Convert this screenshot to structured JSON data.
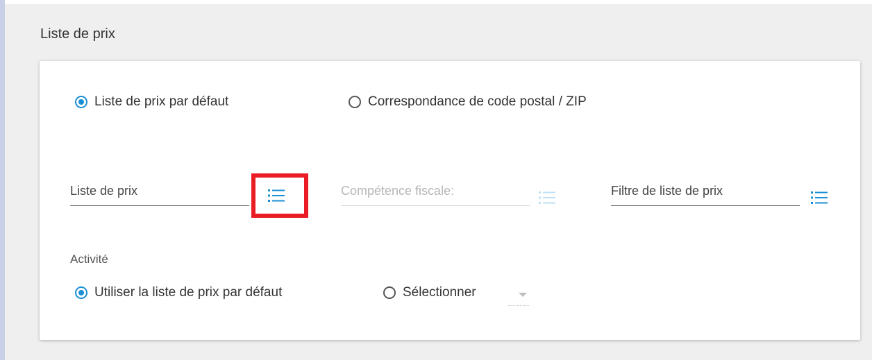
{
  "section": {
    "title": "Liste de prix"
  },
  "mode": {
    "options": [
      {
        "label": "Liste de prix par défaut",
        "selected": true
      },
      {
        "label": "Correspondance de code postal / ZIP",
        "selected": false
      }
    ]
  },
  "fields": {
    "price_list": {
      "label": "Liste de prix",
      "icon": "list-icon",
      "disabled": false
    },
    "tax_jurisdiction": {
      "label": "Compétence fiscale:",
      "icon": "list-icon",
      "disabled": true
    },
    "price_list_filter": {
      "label": "Filtre de liste de prix",
      "icon": "list-icon",
      "disabled": false
    }
  },
  "activity": {
    "label": "Activité",
    "options": [
      {
        "label": "Utiliser la liste de prix par défaut",
        "selected": true
      },
      {
        "label": "Sélectionner",
        "selected": false
      }
    ]
  },
  "colors": {
    "accent": "#1a8fd4",
    "highlight": "#ea1c24",
    "section_bg": "#efefef",
    "side_bar": "#c9cfe6"
  }
}
